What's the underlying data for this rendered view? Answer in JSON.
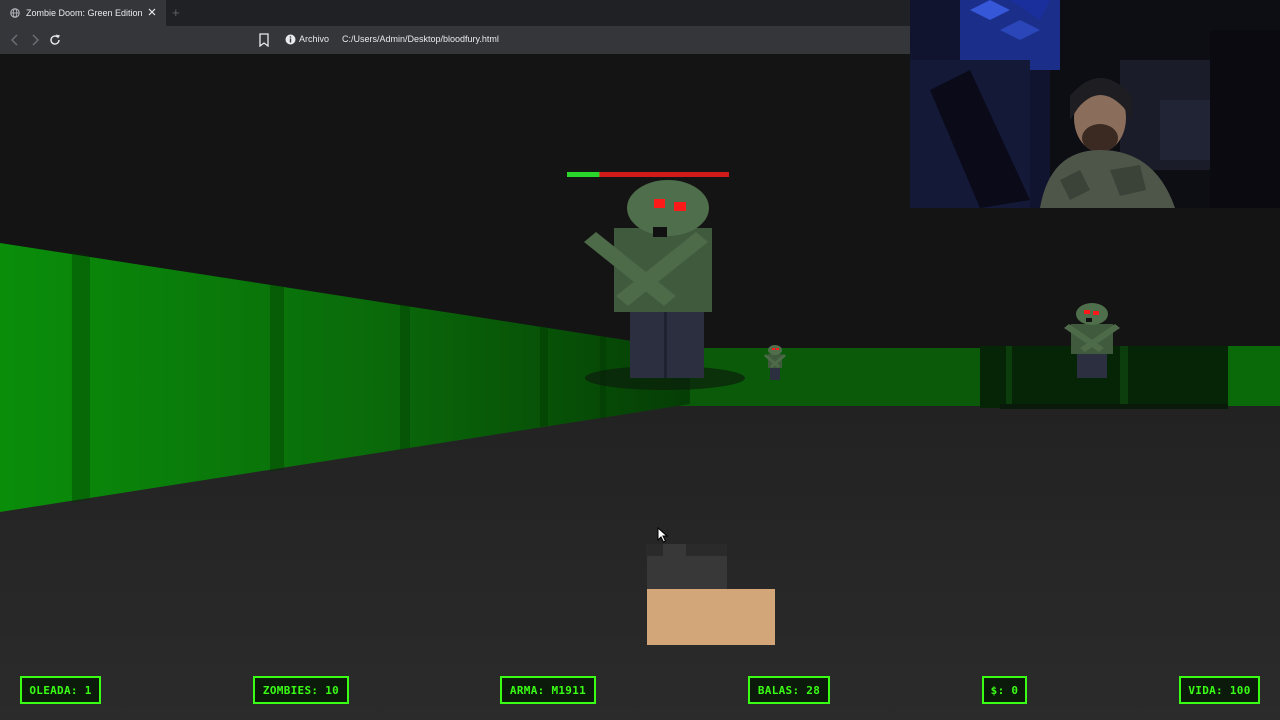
{
  "browser": {
    "tab_title": "Zombie Doom: Green Edition",
    "new_tab_label": "+",
    "site_label": "Archivo",
    "url": "C:/Users/Admin/Desktop/bloodfury.html"
  },
  "enemy": {
    "health_fraction": 0.2
  },
  "hud": {
    "wave": "OLEADA: 1",
    "zombies": "ZOMBIES: 10",
    "weapon": "ARMA: M1911",
    "ammo": "BALAS: 28",
    "money": "$: 0",
    "life": "VIDA: 100"
  },
  "colors": {
    "hud_accent": "#39ff14",
    "wall_green": "#0b8a0b",
    "zombie_green": "#3d5a3a",
    "zombie_eye": "#ff1a1a",
    "floor": "#2a2a2a",
    "ceiling": "#141414"
  }
}
